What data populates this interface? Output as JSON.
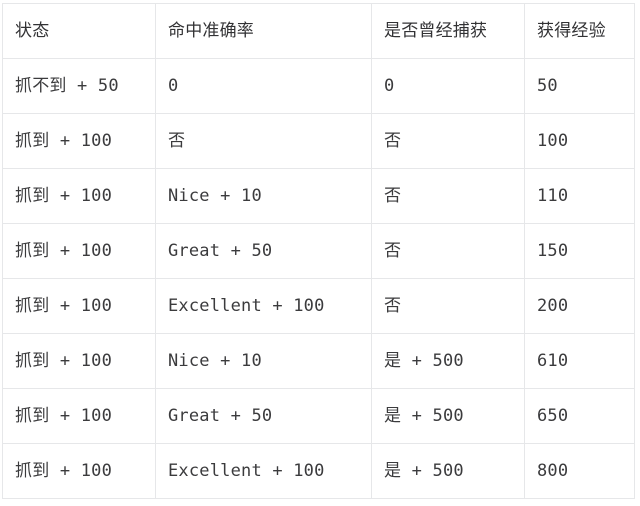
{
  "table": {
    "columns": [
      {
        "key": "status",
        "label": "状态"
      },
      {
        "key": "accuracy",
        "label": "命中准确率"
      },
      {
        "key": "caught",
        "label": "是否曾经捕获"
      },
      {
        "key": "exp",
        "label": "获得经验"
      }
    ],
    "rows": [
      {
        "status": "抓不到 + 50",
        "accuracy": "0",
        "caught": "0",
        "exp": "50"
      },
      {
        "status": "抓到 + 100",
        "accuracy": "否",
        "caught": "否",
        "exp": "100"
      },
      {
        "status": "抓到 + 100",
        "accuracy": "Nice + 10",
        "caught": "否",
        "exp": "110"
      },
      {
        "status": "抓到 + 100",
        "accuracy": "Great + 50",
        "caught": "否",
        "exp": "150"
      },
      {
        "status": "抓到 + 100",
        "accuracy": "Excellent + 100",
        "caught": "否",
        "exp": "200"
      },
      {
        "status": "抓到 + 100",
        "accuracy": "Nice + 10",
        "caught": "是 + 500",
        "exp": "610"
      },
      {
        "status": "抓到 + 100",
        "accuracy": "Great + 50",
        "caught": "是 + 500",
        "exp": "650"
      },
      {
        "status": "抓到 + 100",
        "accuracy": "Excellent + 100",
        "caught": "是 + 500",
        "exp": "800"
      }
    ]
  },
  "style": {
    "border_color": "#e6e7e9",
    "text_color": "#3b3b3d",
    "header_text_color": "#323234",
    "background": "#ffffff"
  }
}
